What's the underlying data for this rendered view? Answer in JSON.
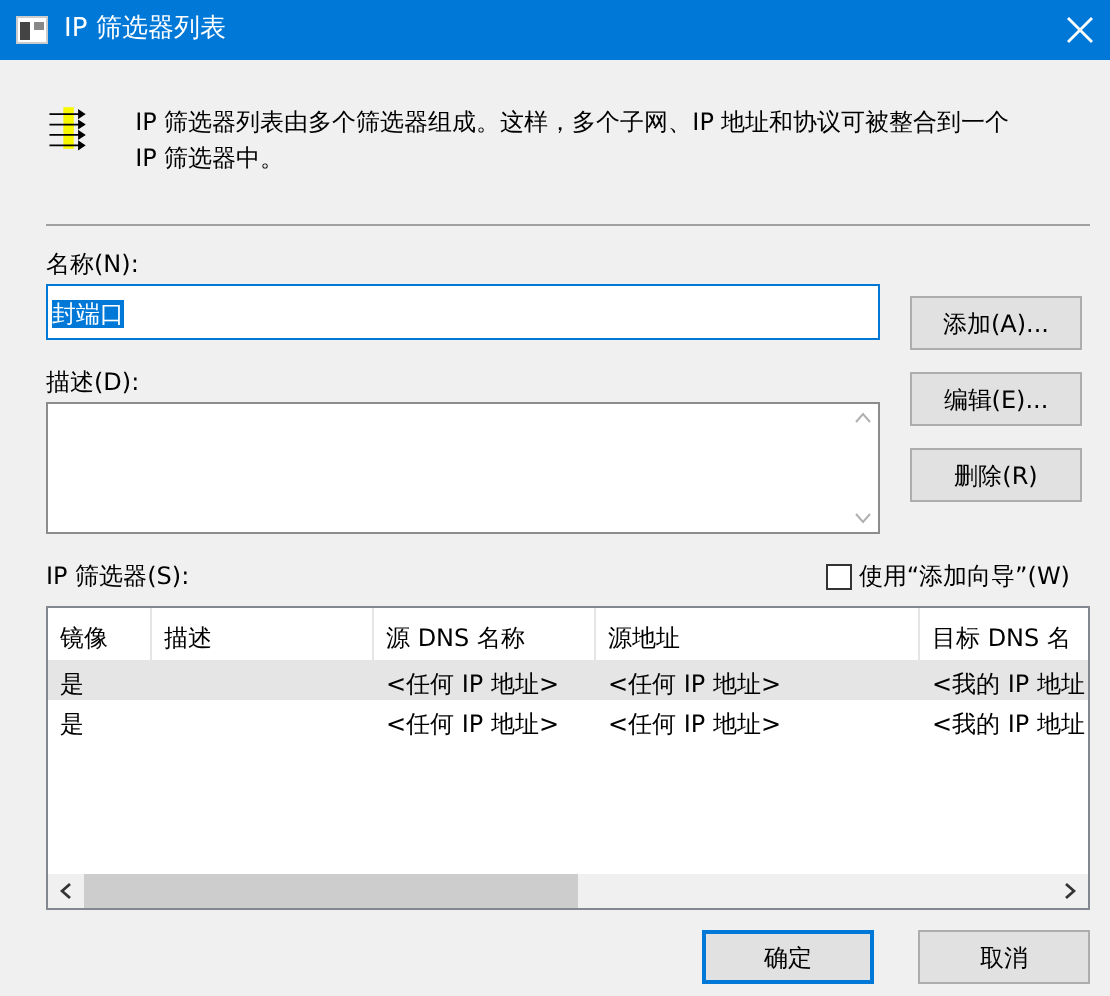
{
  "window": {
    "title": "IP 筛选器列表"
  },
  "intro": "IP 筛选器列表由多个筛选器组成。这样，多个子网、IP 地址和协议可被整合到一个 IP 筛选器中。",
  "name_field": {
    "label": "名称(N):",
    "value": "封端口",
    "text_selected": true
  },
  "description_field": {
    "label": "描述(D):"
  },
  "side_buttons": [
    "添加(A)...",
    "编辑(E)...",
    "删除(R)"
  ],
  "filters_label": "IP 筛选器(S):",
  "wizard_checkbox": {
    "label": "使用“添加向导”(W)",
    "checked": false
  },
  "table": {
    "columns": [
      "镜像",
      "描述",
      "源 DNS 名称",
      "源地址",
      "目标 DNS 名"
    ],
    "rows": [
      {
        "cells": [
          "是",
          "",
          "<任何 IP 地址>",
          "<任何 IP 地址>",
          "<我的 IP 地址"
        ],
        "selected": true
      },
      {
        "cells": [
          "是",
          "",
          "<任何 IP 地址>",
          "<任何 IP 地址>",
          "<我的 IP 地址"
        ],
        "selected": false
      }
    ]
  },
  "footer_buttons": [
    {
      "label": "确定",
      "default": true
    },
    {
      "label": "取消",
      "default": false
    }
  ]
}
